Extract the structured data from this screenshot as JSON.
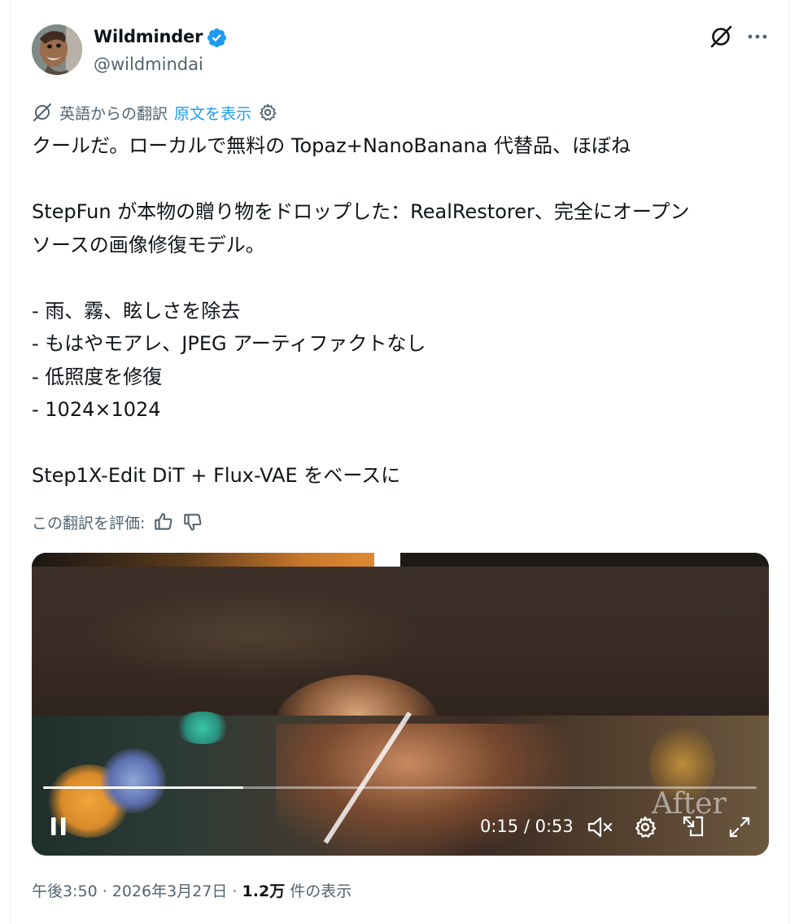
{
  "author": {
    "name": "Wildminder",
    "handle": "@wildmindai"
  },
  "translation": {
    "label": "英語からの翻訳",
    "show_original": "原文を表示"
  },
  "tweet": {
    "lines": "クールだ。ローカルで無料の Topaz+NanoBanana 代替品、ほぼね\n\nStepFun が本物の贈り物をドロップした：RealRestorer、完全にオープン\nソースの画像修復モデル。\n\n- 雨、霧、眩しさを除去\n- もはやモアレ、JPEG アーティファクトなし\n- 低照度を修復\n- 1024×1024\n\nStep1X-Edit DiT + Flux-VAE をベースに"
  },
  "rating": {
    "label": "この翻訳を評価:"
  },
  "video": {
    "time": "0:15 / 0:53",
    "progress": 0.28,
    "overlay_text": "After"
  },
  "meta": {
    "time": "午後3:50",
    "sep1": " · ",
    "date": "2026年3月27日",
    "sep2": " · ",
    "views": "1.2万",
    "views_label": " 件の表示"
  },
  "colors": {
    "link": "#1d9bf0",
    "verified": "#1d9bf0",
    "muted": "#536471"
  },
  "icons": [
    "verified-badge-icon",
    "grok-icon",
    "more-icon",
    "translate-icon",
    "gear-icon",
    "thumbs-up-icon",
    "thumbs-down-icon",
    "pause-icon",
    "mute-icon",
    "settings-icon",
    "pip-icon",
    "fullscreen-icon"
  ]
}
